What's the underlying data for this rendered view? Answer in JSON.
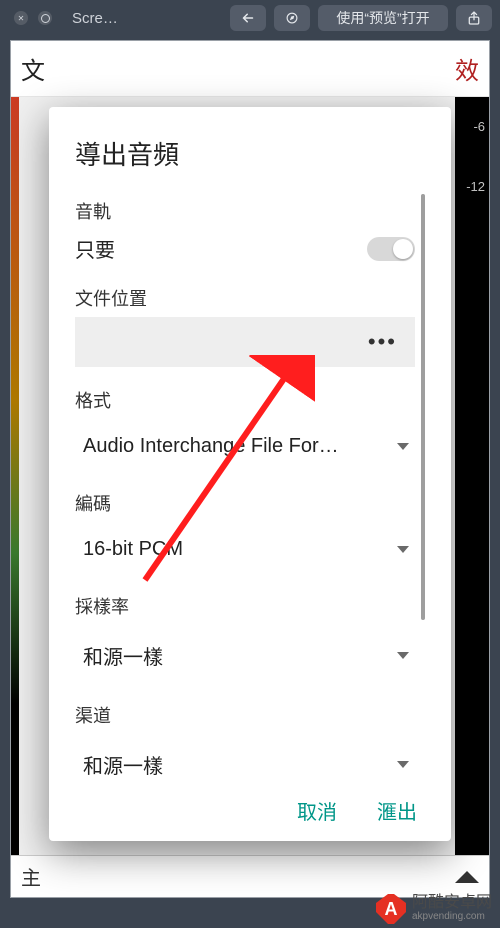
{
  "titlebar": {
    "title": "Scre…",
    "preview_button": "使用“预览”打开"
  },
  "under": {
    "header_left": "文",
    "header_right": "效",
    "footer_left": "主",
    "ruler": [
      "-6",
      "-12",
      "",
      "",
      "",
      "",
      "",
      "",
      "",
      ""
    ]
  },
  "dialog": {
    "title": "導出音頻",
    "track_section": "音軌",
    "only_label": "只要",
    "only_value": false,
    "file_location_label": "文件位置",
    "file_location_more": "•••",
    "format_label": "格式",
    "format_value": "Audio Interchange File For…",
    "encoding_label": "編碼",
    "encoding_value": "16-bit PCM",
    "samplerate_label": "採樣率",
    "samplerate_value": "和源一樣",
    "channel_label": "渠道",
    "channel_value": "和源一樣",
    "cancel": "取消",
    "export": "滙出"
  },
  "watermark": {
    "badge": "A",
    "line1": "阿酷安卓网",
    "line2": "akpvending.com"
  }
}
